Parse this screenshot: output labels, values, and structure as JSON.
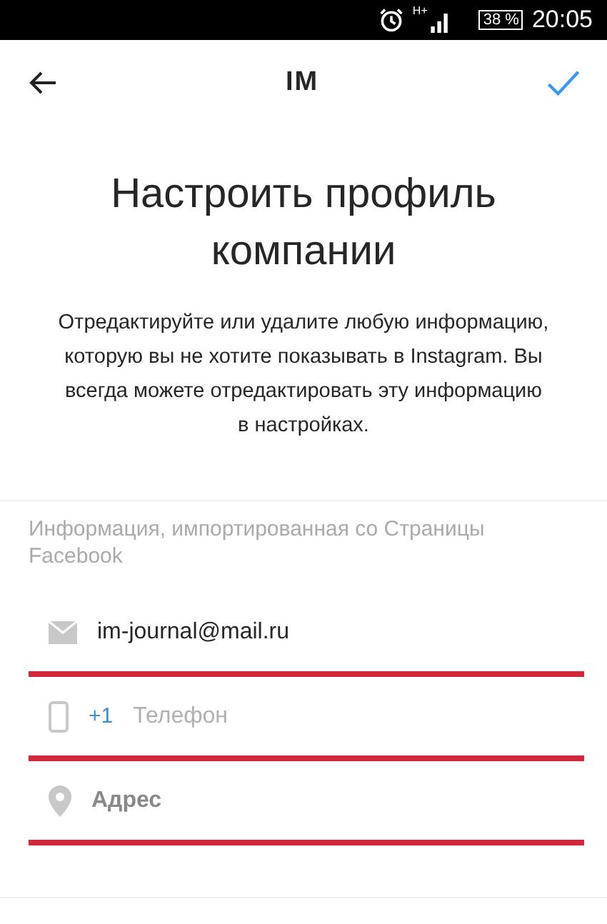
{
  "status_bar": {
    "battery": "38 %",
    "time": "20:05",
    "network": "H+"
  },
  "header": {
    "title": "IM"
  },
  "heading": "Настроить профиль компании",
  "description": "Отредактируйте или удалите любую информацию, которую вы не хотите показывать в Instagram. Вы всегда можете отредактировать эту информацию в настройках.",
  "section": {
    "label": "Информация, импортированная со Страницы Facebook",
    "fields": [
      {
        "kind": "email",
        "value": "im-journal@mail.ru"
      },
      {
        "kind": "phone",
        "prefix": "+1",
        "placeholder": "Телефон"
      },
      {
        "kind": "address",
        "placeholder": "Адрес"
      }
    ]
  }
}
